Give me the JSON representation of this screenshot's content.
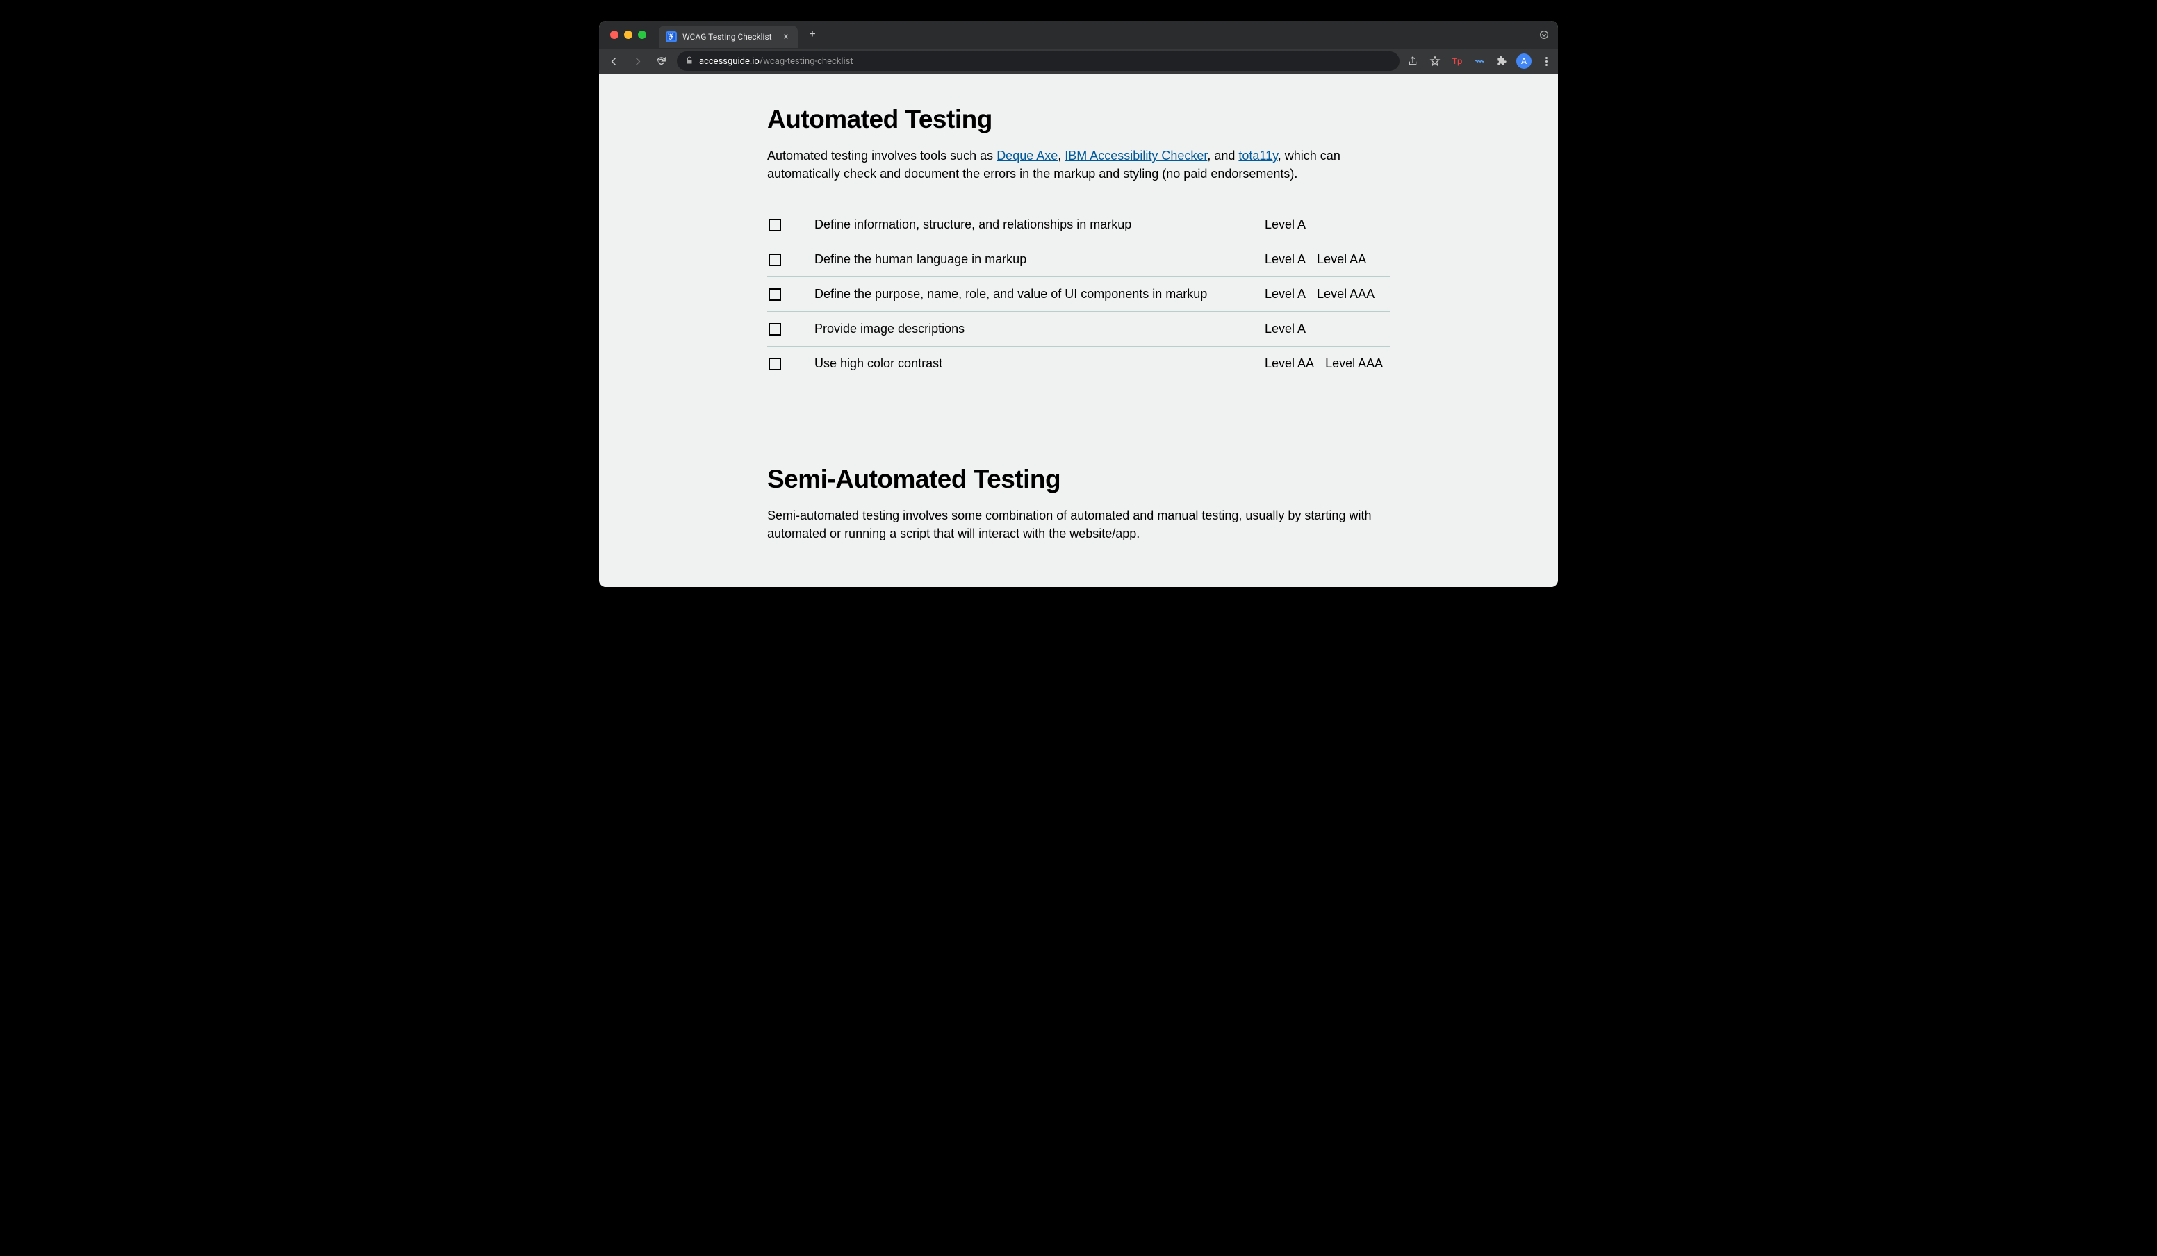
{
  "browser": {
    "tab_title": "WCAG Testing Checklist",
    "url_domain": "accessguide.io",
    "url_path": "/wcag-testing-checklist",
    "profile_initial": "A",
    "ext_tp_label": "Tp"
  },
  "sections": {
    "automated": {
      "title": "Automated Testing",
      "intro_before": "Automated testing involves tools such as ",
      "link1": "Deque Axe",
      "sep1": ", ",
      "link2": "IBM Accessibility Checker",
      "sep2": ", and ",
      "link3": "tota11y",
      "intro_after": ", which can automatically check and document the errors in the markup and styling (no paid endorsements).",
      "items": [
        {
          "label": "Define information, structure, and relationships in markup",
          "levels": [
            "Level A"
          ]
        },
        {
          "label": "Define the human language in markup",
          "levels": [
            "Level A",
            "Level AA"
          ]
        },
        {
          "label": "Define the purpose, name, role, and value of UI components in markup",
          "levels": [
            "Level A",
            "Level AAA"
          ]
        },
        {
          "label": "Provide image descriptions",
          "levels": [
            "Level A"
          ]
        },
        {
          "label": "Use high color contrast",
          "levels": [
            "Level AA",
            "Level AAA"
          ]
        }
      ]
    },
    "semi": {
      "title": "Semi-Automated Testing",
      "intro": "Semi-automated testing involves some combination of automated and manual testing, usually by starting with automated or running a script that will interact with the website/app."
    }
  }
}
